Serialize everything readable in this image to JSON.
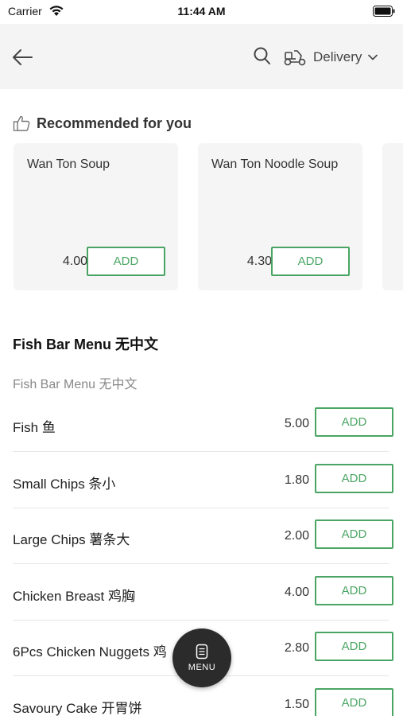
{
  "status_bar": {
    "carrier": "Carrier",
    "time": "11:44 AM"
  },
  "nav": {
    "delivery_label": "Delivery",
    "icons": [
      "back-arrow-icon",
      "search-icon",
      "scooter-icon",
      "chevron-down-icon"
    ]
  },
  "recommended": {
    "title": "Recommended for you",
    "items": [
      {
        "name": "Wan Ton Soup",
        "price": "4.00",
        "add_label": "ADD"
      },
      {
        "name": "Wan Ton Noodle Soup",
        "price": "4.30",
        "add_label": "ADD"
      }
    ]
  },
  "section": {
    "title": "Fish Bar Menu 无中文",
    "subtitle": "Fish Bar Menu 无中文",
    "items": [
      {
        "name": "Fish 鱼",
        "price": "5.00",
        "add_label": "ADD"
      },
      {
        "name": "Small Chips 条小",
        "price": "1.80",
        "add_label": "ADD"
      },
      {
        "name": "Large Chips 薯条大",
        "price": "2.00",
        "add_label": "ADD"
      },
      {
        "name": "Chicken Breast 鸡胸",
        "price": "4.00",
        "add_label": "ADD"
      },
      {
        "name": "6Pcs Chicken Nuggets 鸡",
        "price": "2.80",
        "add_label": "ADD"
      },
      {
        "name": "Savoury Cake 开胃饼",
        "price": "1.50",
        "add_label": "ADD"
      }
    ]
  },
  "fab": {
    "label": "MENU"
  },
  "colors": {
    "accent_green": "#4aa564",
    "nav_background": "#f4f4f4",
    "card_background": "#f5f5f5",
    "fab_background": "#2b2b2b"
  }
}
